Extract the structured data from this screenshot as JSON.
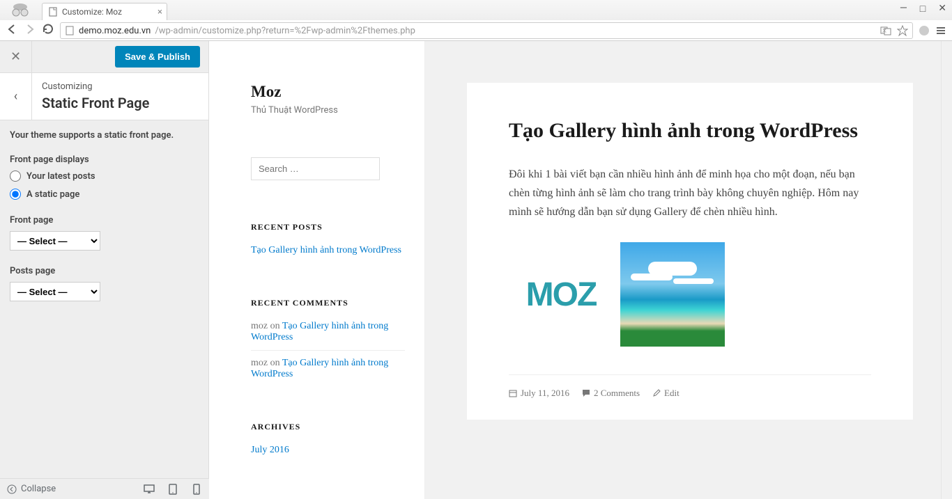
{
  "browser": {
    "tab_title": "Customize: Moz",
    "url_host": "demo.moz.edu.vn",
    "url_path": "/wp-admin/customize.php?return=%2Fwp-admin%2Fthemes.php"
  },
  "customizer": {
    "save_button": "Save & Publish",
    "supertitle": "Customizing",
    "title": "Static Front Page",
    "description": "Your theme supports a static front page.",
    "front_page_displays_label": "Front page displays",
    "radio_latest": "Your latest posts",
    "radio_static": "A static page",
    "front_page_label": "Front page",
    "posts_page_label": "Posts page",
    "select_placeholder": "— Select —",
    "collapse_label": "Collapse"
  },
  "preview": {
    "site_title": "Moz",
    "site_tagline": "Thủ Thuật WordPress",
    "search_placeholder": "Search …",
    "recent_posts_title": "RECENT POSTS",
    "recent_posts": [
      "Tạo Gallery hình ảnh trong WordPress"
    ],
    "recent_comments_title": "RECENT COMMENTS",
    "recent_comments": [
      {
        "author": "moz",
        "on": " on ",
        "post": "Tạo Gallery hình ảnh trong WordPress"
      },
      {
        "author": "moz",
        "on": " on ",
        "post": "Tạo Gallery hình ảnh trong WordPress"
      }
    ],
    "archives_title": "ARCHIVES",
    "archives": [
      "July 2016"
    ],
    "post": {
      "title": "Tạo Gallery hình ảnh trong WordPress",
      "body": "Đôi khi 1 bài viết bạn cần nhiều hình ảnh để minh họa cho một đoạn, nếu bạn chèn từng hình ảnh sẽ làm cho trang trình bày không chuyên nghiệp. Hôm nay mình sẽ hướng dẫn bạn sử dụng Gallery để chèn nhiều hình.",
      "logo_text": "MOZ",
      "date": "July 11, 2016",
      "comments": "2 Comments",
      "edit": "Edit"
    }
  }
}
